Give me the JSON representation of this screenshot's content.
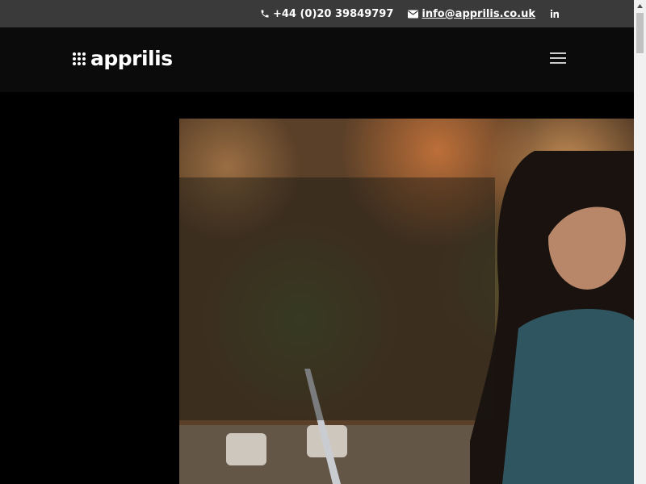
{
  "topbar": {
    "phone": "+44 (0)20 39849797",
    "email": "info@apprilis.co.uk",
    "icons": [
      "phone-icon",
      "envelope-icon",
      "linkedin-icon"
    ]
  },
  "header": {
    "logo_text": "apprilis",
    "menu_icon": "hamburger-menu-icon"
  },
  "hero": {
    "image": "woman-with-laptop-outdoors"
  },
  "colors": {
    "topbar_bg": "#3a3a3a",
    "header_bg": "#0b0b0b",
    "page_bg": "#000000"
  }
}
